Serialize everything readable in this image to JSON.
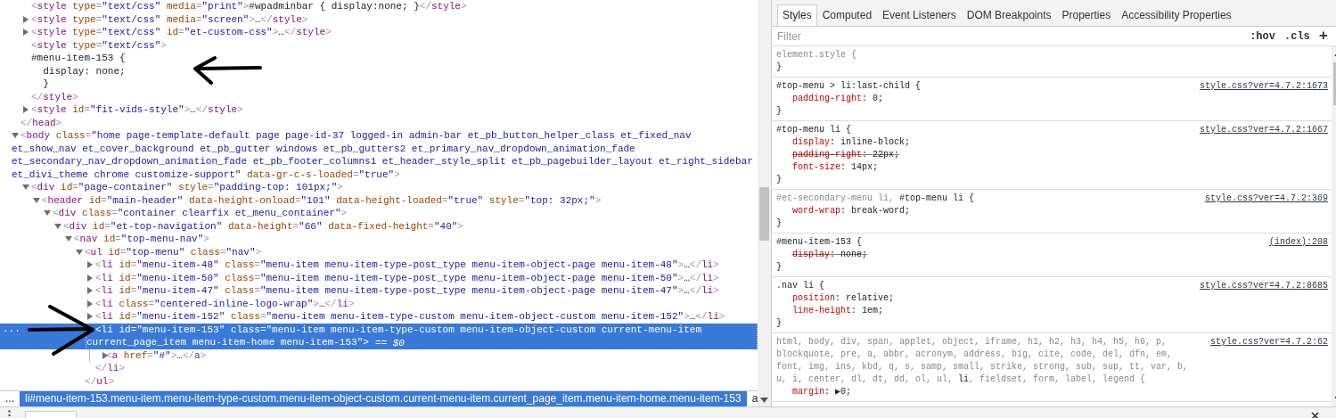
{
  "dom_tree": {
    "nodes": [
      {
        "close": "</head>",
        "children": [
          {
            "text": "<style type=\"text/css\" media=\"print\">#wpadminbar { display:none; }</style>"
          },
          {
            "text": "<style type=\"text/css\" media=\"screen\">…</style>",
            "expanded": false
          },
          {
            "text": "<style type=\"text/css\" id=\"et-custom-css\">…</style>",
            "expanded": false
          },
          {
            "text": "<style type=\"text/css\">",
            "close": "</style>",
            "children": [
              {
                "kind": "text",
                "text": "#menu-item-153 {\n  display: none;\n  }",
                "arrow": true,
                "arrow_left": true
              }
            ]
          },
          {
            "text": "<style id=\"fit-vids-style\">…</style>",
            "expanded": false
          }
        ]
      },
      {
        "text": "<body class=\"home page-template-default page page-id-37 logged-in admin-bar et_pb_button_helper_class et_fixed_nav et_show_nav et_cover_background et_pb_gutter windows et_pb_gutters2 et_primary_nav_dropdown_animation_fade et_secondary_nav_dropdown_animation_fade et_pb_footer_columns1 et_header_style_split et_pb_pagebuilder_layout et_right_sidebar et_divi_theme chrome customize-support\" data-gr-c-s-loaded=\"true\">",
        "expanded": true,
        "children": [
          {
            "text": "<div id=\"page-container\" style=\"padding-top: 101px;\">",
            "expanded": true,
            "children": [
              {
                "text": "<header id=\"main-header\" data-height-onload=\"101\" data-height-loaded=\"true\" style=\"top: 32px;\">",
                "expanded": true,
                "children": [
                  {
                    "text": "<div class=\"container clearfix et_menu_container\">",
                    "expanded": true,
                    "children": [
                      {
                        "text": "<div id=\"et-top-navigation\" data-height=\"66\" data-fixed-height=\"40\">",
                        "expanded": true,
                        "children": [
                          {
                            "text": "<nav id=\"top-menu-nav\">",
                            "expanded": true,
                            "children": [
                              {
                                "text": "<ul id=\"top-menu\" class=\"nav\">",
                                "expanded": true,
                                "close": "</ul>",
                                "children": [
                                  {
                                    "text": "<li id=\"menu-item-48\" class=\"menu-item menu-item-type-post_type menu-item-object-page menu-item-48\">…</li>",
                                    "expanded": false,
                                    "selected": false
                                  },
                                  {
                                    "text": "<li id=\"menu-item-50\" class=\"menu-item menu-item-type-post_type menu-item-object-page menu-item-50\">…</li>",
                                    "expanded": false,
                                    "selected": false
                                  },
                                  {
                                    "text": "<li id=\"menu-item-47\" class=\"menu-item menu-item-type-post_type menu-item-object-page menu-item-47\">…</li>",
                                    "expanded": false,
                                    "selected": false
                                  },
                                  {
                                    "text": "<li class=\"centered-inline-logo-wrap\">…</li>",
                                    "expanded": false,
                                    "selected": false
                                  },
                                  {
                                    "text": "<li id=\"menu-item-152\" class=\"menu-item menu-item-type-custom menu-item-object-custom menu-item-152\">…</li>",
                                    "expanded": false,
                                    "selected": false
                                  },
                                  {
                                    "text": "<li id=\"menu-item-153\" class=\"menu-item menu-item-type-custom menu-item-object-custom current-menu-item current_page_item menu-item-home menu-item-153\">",
                                    "expanded": true,
                                    "selected": true,
                                    "gutter": "...",
                                    "console_ref": "== $0",
                                    "arrow": true,
                                    "arrow_left": false,
                                    "close": "</li>",
                                    "children": [
                                      {
                                        "text": "<a href=\"#\">…</a>",
                                        "expanded": false
                                      }
                                    ]
                                  }
                                ]
                              }
                            ]
                          }
                        ]
                      }
                    ]
                  }
                ]
              }
            ]
          }
        ]
      }
    ]
  },
  "breadcrumbs": {
    "overflow": "...",
    "items": [
      {
        "text": "li#menu-item-153.menu-item.menu-item-type-custom.menu-item-object-custom.current-menu-item.current_page_item.menu-item-home.menu-item-153",
        "selected": true
      },
      {
        "text": "a",
        "selected": false
      }
    ]
  },
  "styles_pane": {
    "tabs": [
      {
        "label": "Styles",
        "selected": true
      },
      {
        "label": "Computed",
        "selected": false
      },
      {
        "label": "Event Listeners",
        "selected": false
      },
      {
        "label": "DOM Breakpoints",
        "selected": false
      },
      {
        "label": "Properties",
        "selected": false
      },
      {
        "label": "Accessibility Properties",
        "selected": false
      }
    ],
    "filter": {
      "placeholder": "Filter"
    },
    "buttons": [
      ":hov",
      ".cls",
      "+"
    ],
    "rules": [
      {
        "selector": [
          {
            "text": "element.style {",
            "matched": false
          }
        ],
        "close": "}"
      },
      {
        "selector": [
          {
            "text": "#top-menu > li:last-child {",
            "matched": true
          }
        ],
        "source": "style.css?ver=4.7.2:1673",
        "declarations": [
          {
            "text": "padding-right: 0;",
            "overridden": false
          }
        ],
        "close": "}"
      },
      {
        "selector": [
          {
            "text": "#top-menu li {",
            "matched": true
          }
        ],
        "source": "style.css?ver=4.7.2:1667",
        "declarations": [
          {
            "text": "display: inline-block;",
            "overridden": false
          },
          {
            "text": "padding-right: 22px;",
            "overridden": true
          },
          {
            "text": "font-size: 14px;",
            "overridden": false
          }
        ],
        "close": "}"
      },
      {
        "selector": [
          {
            "text": "#et-secondary-menu li, ",
            "matched": false
          },
          {
            "text": "#top-menu li {",
            "matched": true
          }
        ],
        "source": "style.css?ver=4.7.2:369",
        "declarations": [
          {
            "text": "word-wrap: break-word;",
            "overridden": false
          }
        ],
        "close": "}"
      },
      {
        "selector": [
          {
            "text": "#menu-item-153 {",
            "matched": true
          }
        ],
        "source": "(index):208",
        "declarations": [
          {
            "text": "display: none;",
            "overridden": true
          }
        ],
        "close": "}"
      },
      {
        "selector": [
          {
            "text": ".nav li {",
            "matched": true
          }
        ],
        "source": "style.css?ver=4.7.2:8685",
        "declarations": [
          {
            "text": "position: relative;",
            "overridden": false
          },
          {
            "text": "line-height: 1em;",
            "overridden": false
          }
        ],
        "close": "}"
      },
      {
        "selector": [
          {
            "text": "html, body, div, span, applet, object, iframe, h1, h2, h3, h4, h5, h6, p, blockquote, pre, a, abbr, acronym, address, big, cite, code, del, dfn, em, font, img, ins, kbd, q, s, samp, small, strike, strong, sub, sup, tt, var, b, u, i, center, dl, dt, dd, ol, ul, ",
            "matched": false
          },
          {
            "text": "li",
            "matched": true
          },
          {
            "text": ", fieldset, form, label, legend {",
            "matched": false
          }
        ],
        "source": "style.css?ver=4.7.2:62",
        "declarations": [
          {
            "text": "margin: ▶0;",
            "overridden": false
          }
        ]
      }
    ]
  }
}
